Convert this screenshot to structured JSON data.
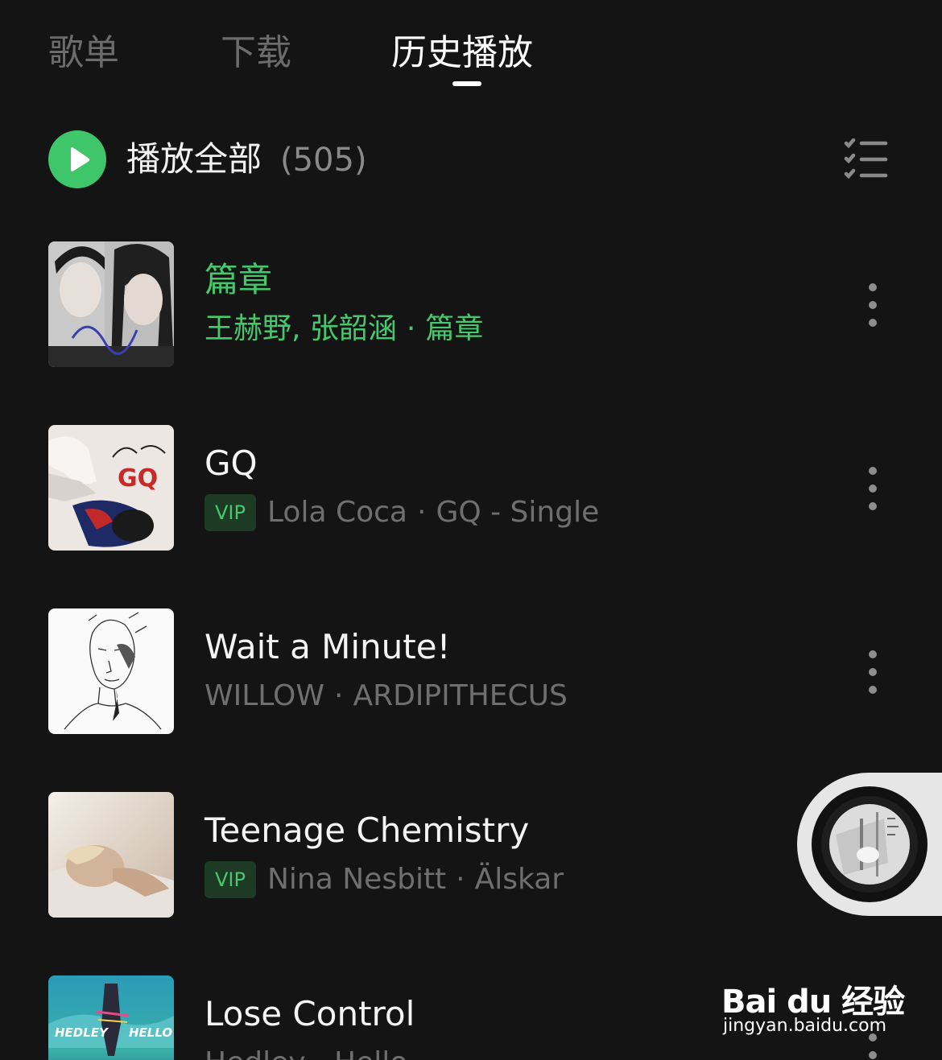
{
  "tabs": [
    {
      "label": "歌单",
      "active": false
    },
    {
      "label": "下载",
      "active": false
    },
    {
      "label": "历史播放",
      "active": true
    }
  ],
  "play_all": {
    "label": "播放全部",
    "count": "(505)",
    "icon": "play-icon"
  },
  "list_icon": "list-select-icon",
  "songs": [
    {
      "title": "篇章",
      "artist": "王赫野, 张韶涵",
      "album": "篇章",
      "vip": false,
      "playing": true,
      "cover": "cover-pianzhang"
    },
    {
      "title": "GQ",
      "artist": "Lola Coca",
      "album": "GQ - Single",
      "vip": true,
      "playing": false,
      "cover": "cover-gq"
    },
    {
      "title": "Wait a Minute!",
      "artist": "WILLOW",
      "album": "ARDIPITHECUS",
      "vip": false,
      "playing": false,
      "cover": "cover-ardipithecus"
    },
    {
      "title": "Teenage Chemistry",
      "artist": "Nina Nesbitt",
      "album": "Älskar",
      "vip": true,
      "playing": false,
      "cover": "cover-alskar"
    },
    {
      "title": "Lose Control",
      "artist": "Hedley",
      "album": "Hello",
      "vip": false,
      "playing": false,
      "cover": "cover-hedley-hello"
    }
  ],
  "vip_label": "VIP",
  "separator": "·",
  "mini_player": {
    "icon": "vinyl-disc-icon"
  },
  "watermark": {
    "logo": "Bai du 经验",
    "url": "jingyan.baidu.com"
  },
  "colors": {
    "accent": "#3fc66a",
    "background": "#141414",
    "muted": "#6f6f6f"
  }
}
